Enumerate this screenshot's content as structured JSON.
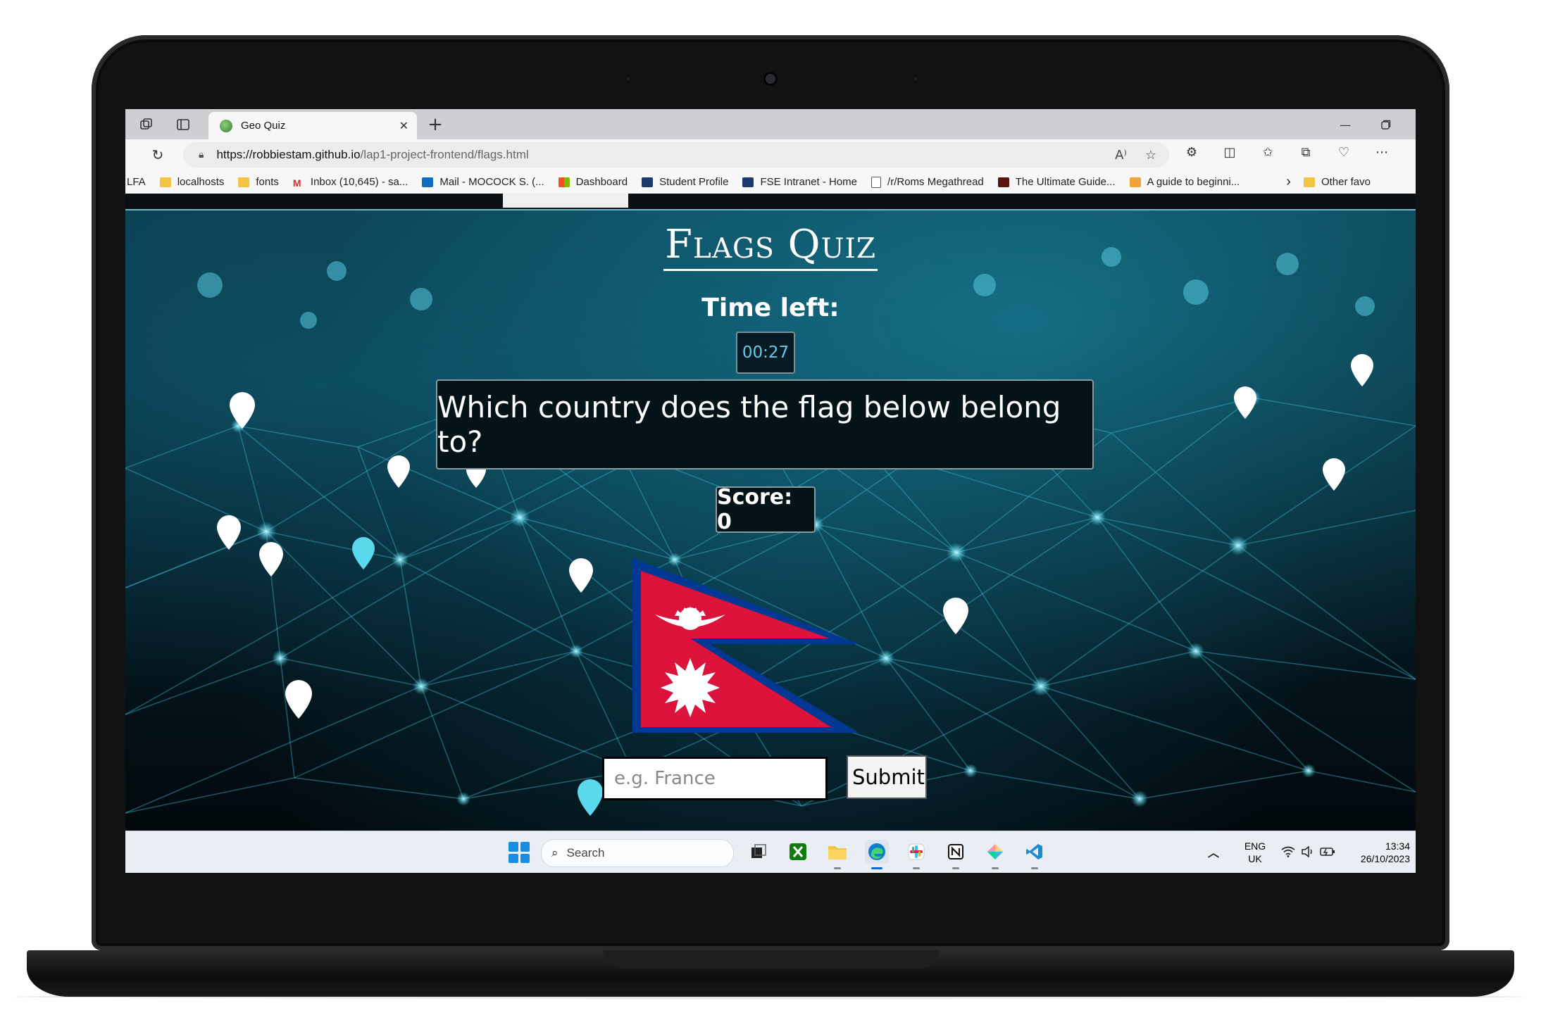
{
  "browser": {
    "tab_title": "Geo Quiz",
    "new_tab_glyph": "+",
    "url_host": "https://robbiestam.github.io",
    "url_path": "/lap1-project-frontend/flags.html",
    "bookmarks": [
      {
        "label": "LFA",
        "icon": "none"
      },
      {
        "label": "localhosts",
        "icon": "folder-icon"
      },
      {
        "label": "fonts",
        "icon": "folder-icon"
      },
      {
        "label": "Inbox (10,645) - sa...",
        "icon": "gmail-icon"
      },
      {
        "label": "Mail - MOCOCK S. (...",
        "icon": "outlook-icon"
      },
      {
        "label": "Dashboard",
        "icon": "microsoft-icon"
      },
      {
        "label": "Student Profile",
        "icon": "student-icon"
      },
      {
        "label": "FSE Intranet - Home",
        "icon": "intranet-icon"
      },
      {
        "label": "/r/Roms Megathread",
        "icon": "document-icon"
      },
      {
        "label": "The Ultimate Guide...",
        "icon": "m-icon"
      },
      {
        "label": "A guide to beginni...",
        "icon": "book-icon"
      }
    ],
    "more_bookmarks_glyph": "›",
    "other_favorites": "Other favo"
  },
  "quiz": {
    "title": "Flags Quiz",
    "time_label": "Time left:",
    "timer": "00:27",
    "question": "Which country does the flag below belong to?",
    "score": "Score: 0",
    "flag_country_shown": "Nepal",
    "answer_placeholder": "e.g. France",
    "answer_value": "",
    "submit_label": "Submit"
  },
  "taskbar": {
    "search_label": "Search",
    "language_line1": "ENG",
    "language_line2": "UK",
    "time": "13:34",
    "date": "26/10/2023"
  },
  "colors": {
    "accent_timer": "#66c9e6",
    "flag_red": "#dc143c",
    "flag_blue": "#003893",
    "page_bg": "#04161e"
  }
}
